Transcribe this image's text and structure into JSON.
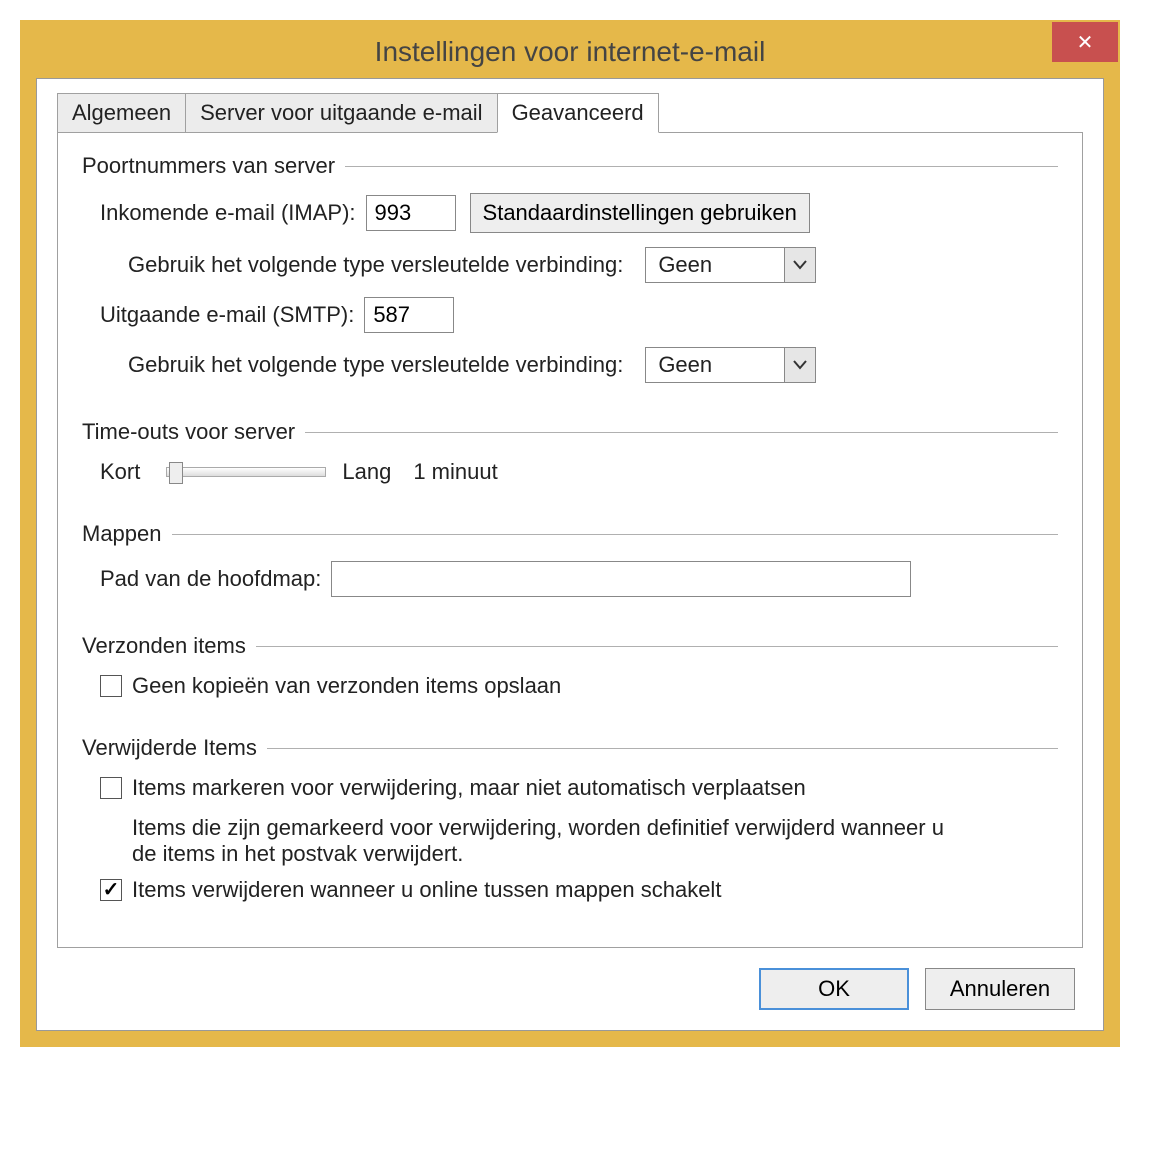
{
  "dialog": {
    "title": "Instellingen voor internet-e-mail",
    "close_x": "✕"
  },
  "tabs": {
    "general": "Algemeen",
    "outgoing": "Server voor uitgaande e-mail",
    "advanced": "Geavanceerd"
  },
  "ports": {
    "legend": "Poortnummers van server",
    "incoming_label": "Inkomende e-mail (IMAP):",
    "incoming_value": "993",
    "defaults_button": "Standaardinstellingen gebruiken",
    "enc_label": "Gebruik het volgende type versleutelde verbinding:",
    "incoming_enc_value": "Geen",
    "outgoing_label": "Uitgaande e-mail (SMTP):",
    "outgoing_value": "587",
    "outgoing_enc_value": "Geen"
  },
  "timeouts": {
    "legend": "Time-outs voor server",
    "short": "Kort",
    "long": "Lang",
    "value": "1 minuut"
  },
  "folders": {
    "legend": "Mappen",
    "rootpath_label": "Pad van de hoofdmap:",
    "rootpath_value": ""
  },
  "sent": {
    "legend": "Verzonden items",
    "no_copy_label": "Geen kopieën van verzonden items opslaan",
    "no_copy_checked": false
  },
  "deleted": {
    "legend": "Verwijderde Items",
    "mark_label": "Items markeren voor verwijdering, maar niet automatisch verplaatsen",
    "mark_checked": false,
    "mark_help": "Items die zijn gemarkeerd voor verwijdering, worden definitief verwijderd wanneer u de items in het postvak verwijdert.",
    "purge_label": "Items verwijderen wanneer u online tussen mappen schakelt",
    "purge_checked": true
  },
  "footer": {
    "ok": "OK",
    "cancel": "Annuleren"
  }
}
